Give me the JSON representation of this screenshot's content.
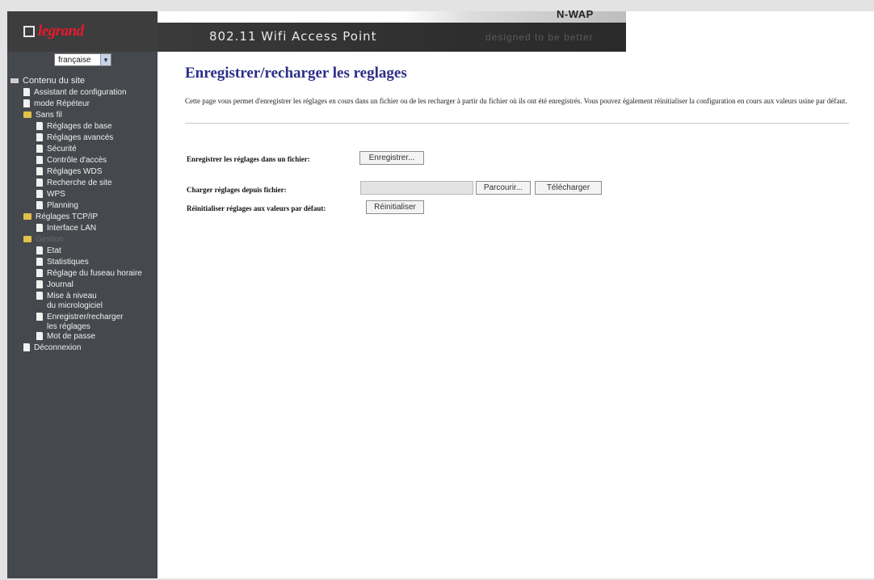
{
  "header": {
    "logo_text": "legrand",
    "title": "802.11 Wifi Access Point",
    "tagline": "designed to be better",
    "brand": "N-WAP"
  },
  "sidebar": {
    "language": {
      "selected": "française"
    },
    "tree": [
      {
        "label": "Contenu du site",
        "type": "root"
      },
      {
        "label": "Assistant de configuration",
        "type": "doc"
      },
      {
        "label": "mode Répéteur",
        "type": "doc"
      },
      {
        "label": "Sans fil",
        "type": "folder"
      },
      {
        "label": "Réglages de base",
        "type": "doc"
      },
      {
        "label": "Réglages avancés",
        "type": "doc"
      },
      {
        "label": "Sécurité",
        "type": "doc"
      },
      {
        "label": "Contrôle d'accès",
        "type": "doc"
      },
      {
        "label": "Réglages WDS",
        "type": "doc"
      },
      {
        "label": "Recherche de site",
        "type": "doc"
      },
      {
        "label": "WPS",
        "type": "doc"
      },
      {
        "label": "Planning",
        "type": "doc"
      },
      {
        "label": "Réglages TCP/IP",
        "type": "folder"
      },
      {
        "label": "Interface LAN",
        "type": "doc"
      },
      {
        "label": "Gestion",
        "type": "folder"
      },
      {
        "label": "Etat",
        "type": "doc"
      },
      {
        "label": "Statistiques",
        "type": "doc"
      },
      {
        "label": "Réglage du fuseau horaire",
        "type": "doc"
      },
      {
        "label": "Journal",
        "type": "doc"
      },
      {
        "label": "Mise à niveau",
        "type": "doc"
      },
      {
        "label": "du micrologiciel",
        "type": "cont"
      },
      {
        "label": "Enregistrer/recharger",
        "type": "doc"
      },
      {
        "label": "les réglages",
        "type": "cont"
      },
      {
        "label": "Mot de passe",
        "type": "doc"
      },
      {
        "label": "Déconnexion",
        "type": "doc"
      }
    ]
  },
  "main": {
    "title": "Enregistrer/recharger les reglages",
    "description": "Cette page vous permet d'enregistrer les réglages en cours dans un fichier ou de les recharger à partir du fichier où ils ont été enregistrés. Vous pouvez également réinitialiser la configuration en cours aux valeurs usine par défaut.",
    "save_label": "Enregistrer les réglages dans un fichier:",
    "save_button": "Enregistrer...",
    "load_label": "Charger réglages depuis fichier:",
    "file_value": "",
    "browse_button": "Parcourir...",
    "upload_button": "Télécharger",
    "reset_label": "Réinitialiser réglages aux valeurs par défaut:",
    "reset_button": "Réinitialiser"
  }
}
